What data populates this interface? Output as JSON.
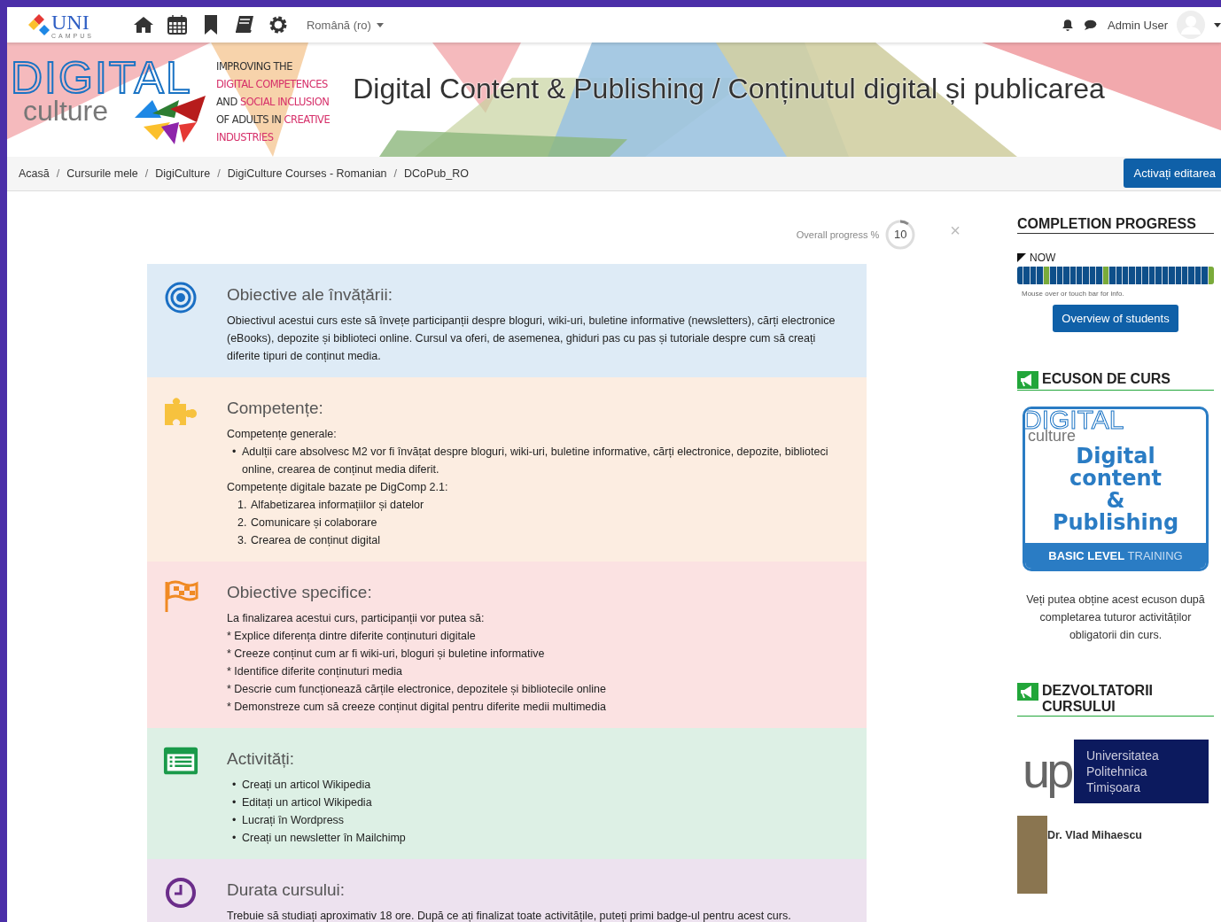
{
  "navbar": {
    "logo": {
      "title": "UNI",
      "subtitle": "CAMPUS"
    },
    "language": "Română (ro)",
    "user": "Admin User"
  },
  "banner": {
    "logo": {
      "word": "DIGITAL",
      "sub": "culture"
    },
    "tagline": [
      [
        {
          "text": "IMPROVING THE",
          "highlight": false
        }
      ],
      [
        {
          "text": "DIGITAL COMPETENCES",
          "highlight": true
        }
      ],
      [
        {
          "text": "AND ",
          "highlight": false
        },
        {
          "text": "SOCIAL INCLUSION",
          "highlight": true
        }
      ],
      [
        {
          "text": "OF ADULTS IN ",
          "highlight": false
        },
        {
          "text": "CREATIVE",
          "highlight": true
        }
      ],
      [
        {
          "text": "INDUSTRIES",
          "highlight": true
        }
      ]
    ],
    "title": "Digital Content & Publishing / Conținutul digital și publicarea"
  },
  "breadcrumb": [
    {
      "label": "Acasă"
    },
    {
      "separator": "/",
      "label": "Cursurile mele"
    },
    {
      "separator": "/",
      "label": "DigiCulture"
    },
    {
      "separator": "/",
      "label": "DigiCulture Courses - Romanian"
    },
    {
      "separator": "/",
      "label": "DCoPub_RO"
    }
  ],
  "edit_button": "Activați editarea",
  "progress": {
    "label": "Overall progress %",
    "value": "10",
    "level": 0.1,
    "close": "×"
  },
  "sections": [
    {
      "kind": "target",
      "color": "#deebf6",
      "title": "Obiective ale învățării:",
      "body": [
        {
          "kind": "text",
          "text": "Obiectivul acestui curs este să învețe participanții despre bloguri, wiki-uri, buletine informative (newsletters), cărți electronice (eBooks), depozite și biblioteci online. Cursul va oferi, de asemenea, ghiduri pas cu pas și tutoriale despre cum să creați diferite tipuri de conținut media."
        }
      ]
    },
    {
      "kind": "puzzle",
      "color": "#fcede1",
      "title": "Competențe:",
      "body": [
        {
          "kind": "text",
          "text": "Competențe generale:"
        },
        {
          "kind": "list",
          "items": [
            {
              "marker": "•",
              "text": "Adulții care absolvesc M2 vor fi învățat despre bloguri, wiki-uri, buletine informative, cărți electronice, depozite, biblioteci online, crearea de conținut media diferit."
            }
          ]
        },
        {
          "kind": "text",
          "text": "Competențe digitale bazate pe DigComp 2.1:"
        },
        {
          "kind": "numbered",
          "items": [
            {
              "marker": "1.",
              "text": "Alfabetizarea informațiilor și datelor"
            },
            {
              "marker": "2.",
              "text": "Comunicare și colaborare"
            },
            {
              "marker": "3.",
              "text": "Crearea de conținut digital"
            }
          ]
        }
      ]
    },
    {
      "kind": "flag",
      "color": "#fbe2e2",
      "title": "Obiective specifice:",
      "body": [
        {
          "kind": "text",
          "text": "La finalizarea acestui curs, participanții vor putea să:"
        },
        {
          "kind": "text",
          "text": "* Explice diferența dintre diferite conținuturi digitale"
        },
        {
          "kind": "text",
          "text": "* Creeze conținut cum ar fi wiki-uri, bloguri și buletine informative"
        },
        {
          "kind": "text",
          "text": "* Identifice diferite conținuturi media"
        },
        {
          "kind": "text",
          "text": "* Descrie cum funcționează cărțile electronice, depozitele și bibliotecile online"
        },
        {
          "kind": "text",
          "text": "* Demonstreze cum să creeze conținut digital pentru diferite medii multimedia"
        }
      ]
    },
    {
      "kind": "list",
      "color": "#ddf0e5",
      "title": "Activități:",
      "body": [
        {
          "kind": "list",
          "items": [
            {
              "marker": "•",
              "text": "Creați un articol Wikipedia"
            },
            {
              "marker": "•",
              "text": "Editați un articol Wikipedia"
            },
            {
              "marker": "•",
              "text": "Lucrați în Wordpress"
            },
            {
              "marker": "•",
              "text": "Creați un newsletter în Mailchimp"
            }
          ]
        }
      ]
    },
    {
      "kind": "clock",
      "color": "#ede2ef",
      "title": "Durata cursului:",
      "body": [
        {
          "kind": "text",
          "text": "Trebuie să studiați aproximativ 18 ore. După ce ați finalizat toate activitățile, puteți primi badge-ul pentru acest curs."
        }
      ]
    }
  ],
  "completion": {
    "title": "COMPLETION PROGRESS",
    "now": "NOW",
    "segments": [
      {
        "completed": false
      },
      {
        "completed": false
      },
      {
        "completed": false
      },
      {
        "completed": false
      },
      {
        "completed": true
      },
      {
        "completed": false
      },
      {
        "completed": false
      },
      {
        "completed": false
      },
      {
        "completed": false
      },
      {
        "completed": false
      },
      {
        "completed": false
      },
      {
        "completed": false
      },
      {
        "completed": false
      },
      {
        "completed": true
      },
      {
        "completed": false
      },
      {
        "completed": false
      },
      {
        "completed": false
      },
      {
        "completed": false
      },
      {
        "completed": false
      },
      {
        "completed": false
      },
      {
        "completed": false
      },
      {
        "completed": false
      },
      {
        "completed": false
      },
      {
        "completed": false
      },
      {
        "completed": false
      },
      {
        "completed": false
      },
      {
        "completed": false
      },
      {
        "completed": false
      },
      {
        "completed": false
      },
      {
        "completed": true
      }
    ],
    "hint": "Mouse over or touch bar for info.",
    "button": "Overview of students"
  },
  "badge": {
    "title": "ECUSON DE CURS",
    "logo_word": "DIGITAL",
    "logo_sub": "culture",
    "lines": [
      "Digital",
      "content",
      "&",
      "Publishing"
    ],
    "footer_bold": "BASIC LEVEL",
    "footer_rest": "TRAINING",
    "note": "Veți putea obține acest ecuson după completarea tuturor activităților obligatorii din curs."
  },
  "developers": {
    "title": "DEZVOLTATORII CURSULUI",
    "university_mark": "up",
    "university_lines": [
      "Universitatea",
      "Politehnica",
      "Timișoara"
    ],
    "people": [
      {
        "name": "Dr. Vlad Mihaescu"
      }
    ]
  }
}
